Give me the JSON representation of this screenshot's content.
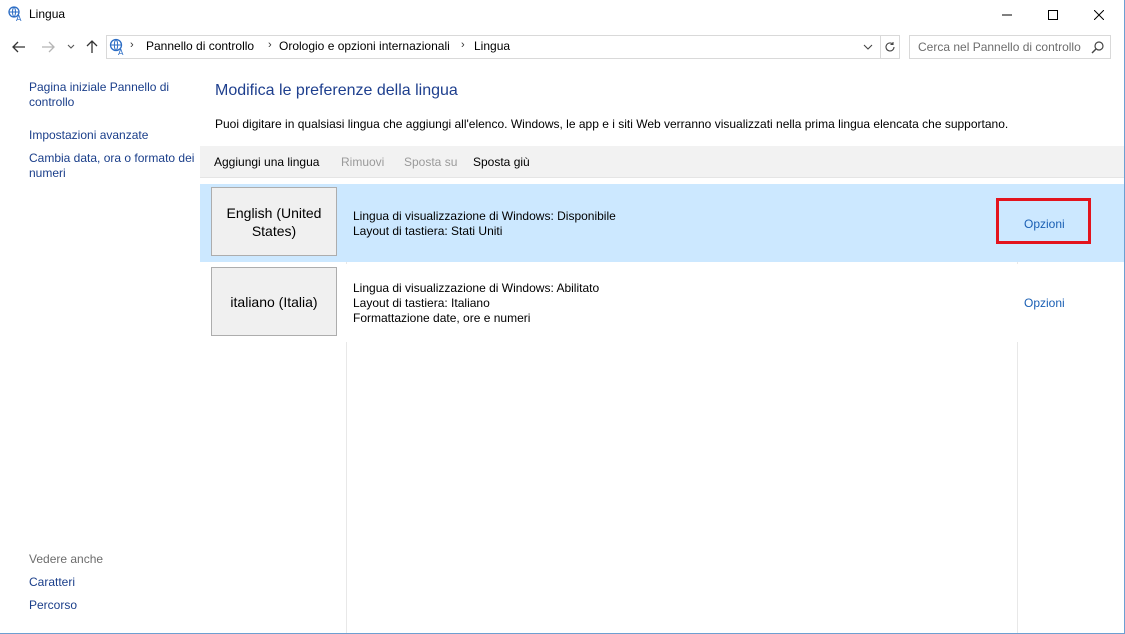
{
  "window": {
    "title": "Lingua",
    "accent": "#1e3f8e"
  },
  "address": {
    "crumbs": [
      "Pannello di controllo",
      "Orologio e opzioni internazionali",
      "Lingua"
    ],
    "search_placeholder": "Cerca nel Pannello di controllo"
  },
  "sidebar": {
    "links": [
      {
        "label": "Pagina iniziale Pannello di controllo"
      },
      {
        "label": "Impostazioni avanzate"
      },
      {
        "label": "Cambia data, ora o formato dei numeri"
      }
    ],
    "see_also_title": "Vedere anche",
    "see_also": [
      {
        "label": "Caratteri"
      },
      {
        "label": "Percorso"
      }
    ]
  },
  "main": {
    "title": "Modifica le preferenze della lingua",
    "description": "Puoi digitare in qualsiasi lingua che aggiungi all'elenco. Windows, le app e i siti Web verranno visualizzati nella prima lingua elencata che supportano.",
    "toolbar": {
      "add": "Aggiungi una lingua",
      "remove": "Rimuovi",
      "move_up": "Sposta su",
      "move_down": "Sposta giù"
    },
    "languages": [
      {
        "name": "English (United States)",
        "lines": [
          "Lingua di visualizzazione di Windows: Disponibile",
          "Layout di tastiera: Stati Uniti"
        ],
        "options": "Opzioni",
        "selected": true
      },
      {
        "name": "italiano (Italia)",
        "lines": [
          "Lingua di visualizzazione di Windows: Abilitato",
          "Layout di tastiera: Italiano",
          "Formattazione date, ore e numeri"
        ],
        "options": "Opzioni",
        "selected": false
      }
    ]
  }
}
